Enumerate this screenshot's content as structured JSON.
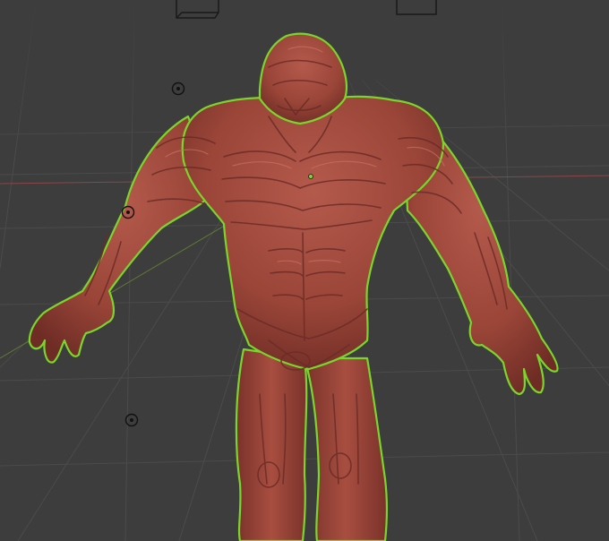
{
  "viewport": {
    "background_color": "#3d3d3d",
    "grid_color": "#4a4a4a",
    "x_axis_color": "#8a4747",
    "y_axis_color": "#6b8a3a",
    "selection_outline_color": "#7bd62b",
    "mesh_color": "#9c4a3f",
    "mesh_shadow_color": "#6b2c26",
    "mesh_highlight_color": "#c26a5c"
  },
  "objects": [
    {
      "name": "sculpted-creature-mesh",
      "selected": true
    },
    {
      "name": "empty-object-1",
      "icon": "empty-target-icon"
    },
    {
      "name": "empty-object-2",
      "icon": "empty-target-icon"
    },
    {
      "name": "empty-object-3",
      "icon": "empty-target-icon"
    },
    {
      "name": "camera-object-left",
      "icon": "box-wireframe-icon"
    },
    {
      "name": "camera-object-right",
      "icon": "box-wireframe-icon"
    }
  ]
}
